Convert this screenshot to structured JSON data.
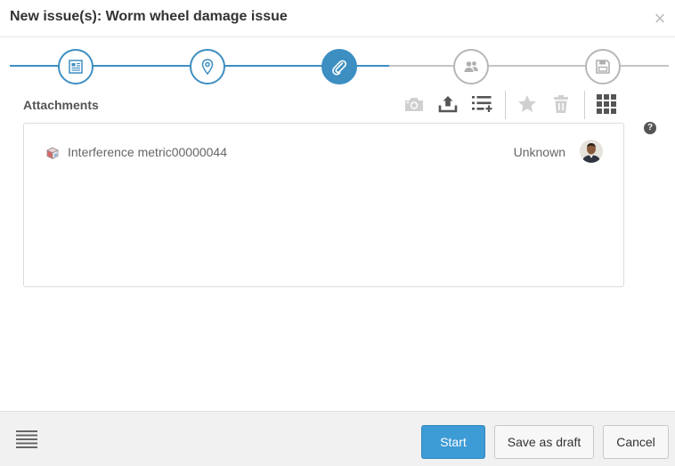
{
  "dialog": {
    "title": "New issue(s): Worm wheel damage issue",
    "close_label": "×"
  },
  "wizard": {
    "current_step": 3,
    "steps": [
      {
        "icon": "details-icon",
        "state": "done"
      },
      {
        "icon": "location-pin-icon",
        "state": "done"
      },
      {
        "icon": "paperclip-icon",
        "state": "active"
      },
      {
        "icon": "users-icon",
        "state": "future"
      },
      {
        "icon": "save-disk-icon",
        "state": "future"
      }
    ]
  },
  "attachments": {
    "label": "Attachments",
    "help": "?",
    "toolbar": [
      {
        "icon": "camera-icon",
        "enabled": false
      },
      {
        "icon": "upload-icon",
        "enabled": true
      },
      {
        "icon": "add-list-icon",
        "enabled": true
      },
      {
        "icon": "star-icon",
        "enabled": false
      },
      {
        "icon": "trash-icon",
        "enabled": false
      },
      {
        "icon": "grid-view-icon",
        "enabled": true
      }
    ],
    "items": [
      {
        "name": "Interference metric00000044",
        "status": "Unknown",
        "icon": "3d-model-icon",
        "avatar": "user-avatar"
      }
    ]
  },
  "footer": {
    "menu_icon": "list-menu-icon",
    "start_label": "Start",
    "draft_label": "Save as draft",
    "cancel_label": "Cancel"
  },
  "colors": {
    "accent": "#3d8fc2",
    "primary_button": "#3d9bd6",
    "inactive": "#b7b7b7"
  }
}
